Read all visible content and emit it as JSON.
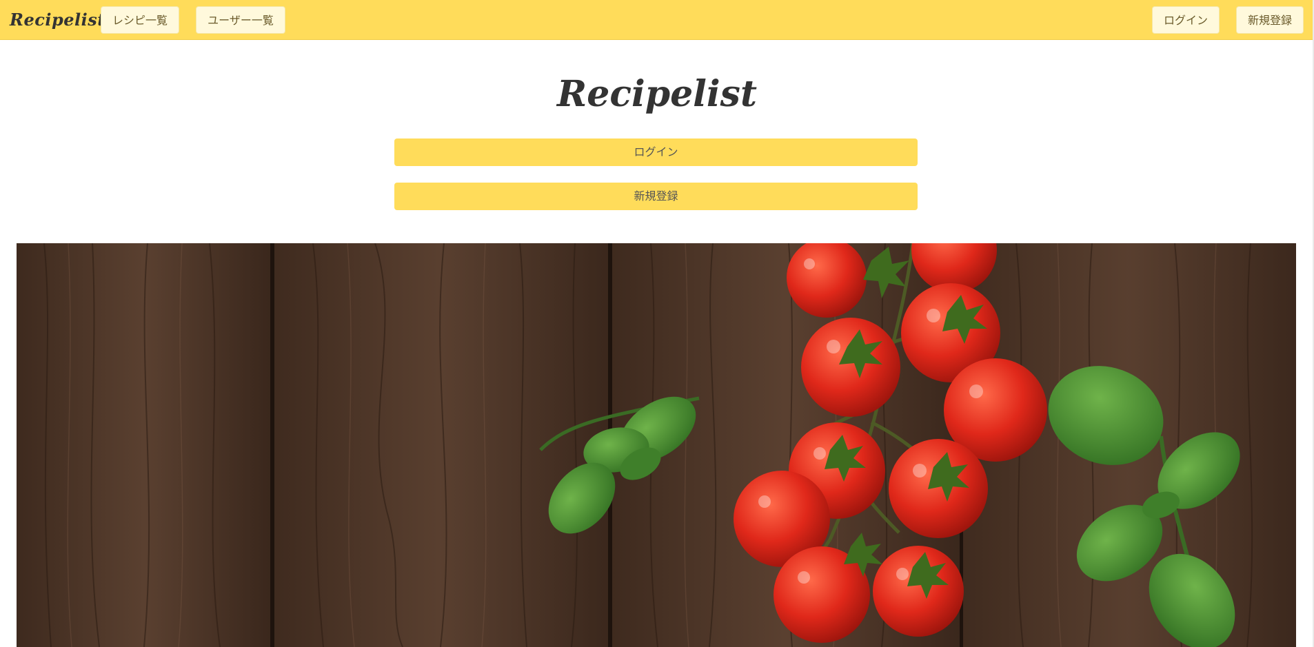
{
  "navbar": {
    "brand": "Recipelist",
    "links": [
      {
        "label": "レシピ一覧"
      },
      {
        "label": "ユーザー一覧"
      }
    ],
    "login_label": "ログイン",
    "signup_label": "新規登録"
  },
  "hero": {
    "title": "Recipelist",
    "login_button": "ログイン",
    "signup_button": "新規登録"
  },
  "colors": {
    "accent": "#ffdc5a",
    "nav_button_bg": "#fff9dc",
    "text": "#333333"
  }
}
